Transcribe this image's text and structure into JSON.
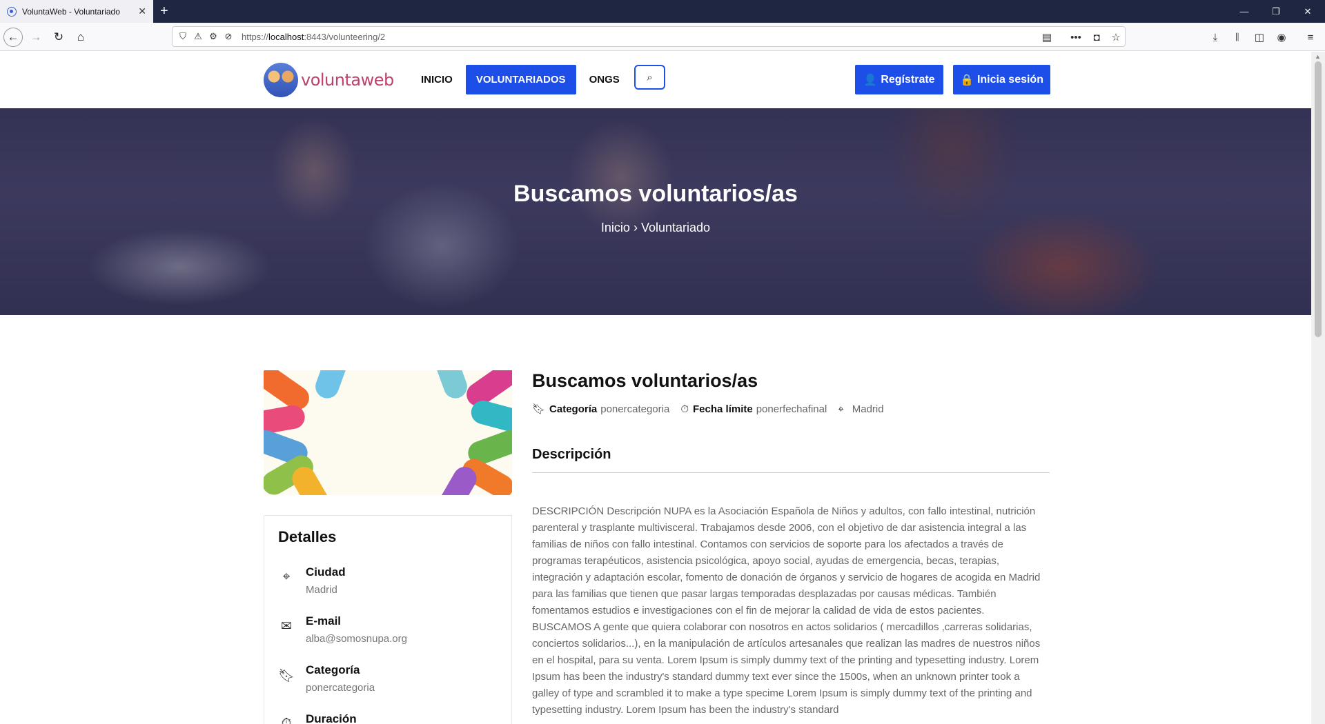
{
  "browser": {
    "tab_title": "VoluntaWeb - Voluntariado",
    "url_prefix": "https://",
    "url_host": "localhost",
    "url_rest": ":8443/volunteering/2"
  },
  "site": {
    "logo_text": "voluntaweb",
    "nav": [
      "INICIO",
      "VOLUNTARIADOS",
      "ONGS"
    ],
    "register_label": "Regístrate",
    "login_label": "Inicia sesión"
  },
  "hero": {
    "title": "Buscamos voluntarios/as",
    "crumb_home": "Inicio",
    "crumb_sep": "›",
    "crumb_current": "Voluntariado"
  },
  "post": {
    "title": "Buscamos voluntarios/as",
    "category_label": "Categoría",
    "category_value": "ponercategoria",
    "deadline_label": "Fecha límite",
    "deadline_value": "ponerfechafinal",
    "city": "Madrid",
    "description_heading": "Descripción",
    "description": "DESCRIPCIÓN Descripción NUPA es la Asociación Española de Niños y adultos, con fallo intestinal, nutrición parenteral y trasplante multivisceral. Trabajamos desde 2006, con el objetivo de dar asistencia integral a las familias de niños con fallo intestinal. Contamos con servicios de soporte para los afectados a través de programas terapéuticos, asistencia psicológica, apoyo social, ayudas de emergencia, becas, terapias, integración y adaptación escolar, fomento de donación de órganos y servicio de hogares de acogida en Madrid para las familias que tienen que pasar largas temporadas desplazadas por causas médicas. También fomentamos estudios e investigaciones con el fin de mejorar la calidad de vida de estos pacientes. BUSCAMOS A gente que quiera colaborar con nosotros en actos solidarios ( mercadillos ,carreras solidarias, conciertos solidarios...), en la manipulación de artículos artesanales que realizan las madres de nuestros niños en el hospital, para su venta. Lorem Ipsum is simply dummy text of the printing and typesetting industry. Lorem Ipsum has been the industry's standard dummy text ever since the 1500s, when an unknown printer took a galley of type and scrambled it to make a type specime Lorem Ipsum is simply dummy text of the printing and typesetting industry. Lorem Ipsum has been the industry's standard"
  },
  "details": {
    "heading": "Detalles",
    "rows": [
      {
        "label": "Ciudad",
        "value": "Madrid",
        "icon": "map-pin-icon"
      },
      {
        "label": "E-mail",
        "value": "alba@somosnupa.org",
        "icon": "envelope-icon"
      },
      {
        "label": "Categoría",
        "value": "ponercategoria",
        "icon": "bookmark-icon"
      },
      {
        "label": "Duración",
        "value": "",
        "icon": "stopwatch-icon"
      }
    ]
  },
  "colors": {
    "accent": "#1d4ee8",
    "logo": "#c0406b",
    "titlebar": "#1e2641"
  }
}
